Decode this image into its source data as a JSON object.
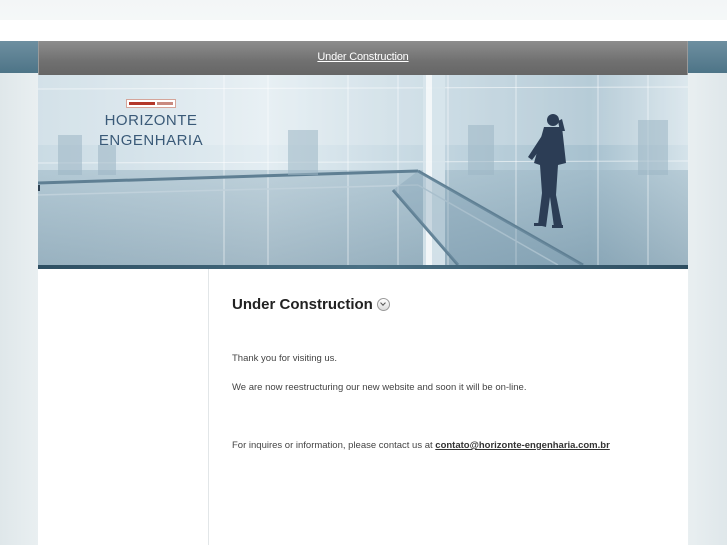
{
  "topbar": {
    "link_label": "Under Construction"
  },
  "banner": {
    "logo_line1": "HORIZONTE",
    "logo_line2": "ENGENHARIA"
  },
  "content": {
    "heading": "Under Construction",
    "para1": "Thank you for visiting us.",
    "para2": "We are now reestructuring our new website and soon it will be on-line.",
    "para3_prefix": "For inquires or information, please contact us at ",
    "email": "contato@horizonte-engenharia.com.br"
  },
  "colors": {
    "topbar_bg": "#707070",
    "heading_text": "#222222",
    "body_text": "#444444",
    "logo_text": "#3a5a78",
    "logo_red": "#b3372a"
  },
  "icons": {
    "heading_icon": "chevron-down-icon"
  }
}
